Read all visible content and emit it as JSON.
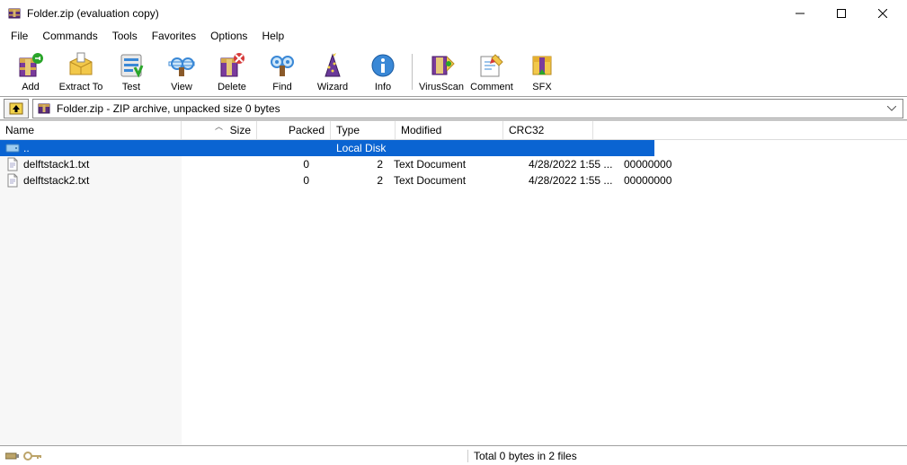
{
  "window": {
    "title": "Folder.zip (evaluation copy)"
  },
  "menu": {
    "file": "File",
    "commands": "Commands",
    "tools": "Tools",
    "favorites": "Favorites",
    "options": "Options",
    "help": "Help"
  },
  "toolbar": {
    "add": "Add",
    "extract": "Extract To",
    "test": "Test",
    "view": "View",
    "delete": "Delete",
    "find": "Find",
    "wizard": "Wizard",
    "info": "Info",
    "virus": "VirusScan",
    "comment": "Comment",
    "sfx": "SFX"
  },
  "address": {
    "text": "Folder.zip - ZIP archive, unpacked size 0 bytes"
  },
  "columns": {
    "name": "Name",
    "size": "Size",
    "packed": "Packed",
    "type": "Type",
    "modified": "Modified",
    "crc32": "CRC32"
  },
  "parentrow": {
    "name": "..",
    "type": "Local Disk"
  },
  "files": [
    {
      "name": "delftstack1.txt",
      "size": "0",
      "packed": "2",
      "type": "Text Document",
      "modified": "4/28/2022 1:55 ...",
      "crc32": "00000000"
    },
    {
      "name": "delftstack2.txt",
      "size": "0",
      "packed": "2",
      "type": "Text Document",
      "modified": "4/28/2022 1:55 ...",
      "crc32": "00000000"
    }
  ],
  "status": {
    "total": "Total 0 bytes in 2 files"
  }
}
